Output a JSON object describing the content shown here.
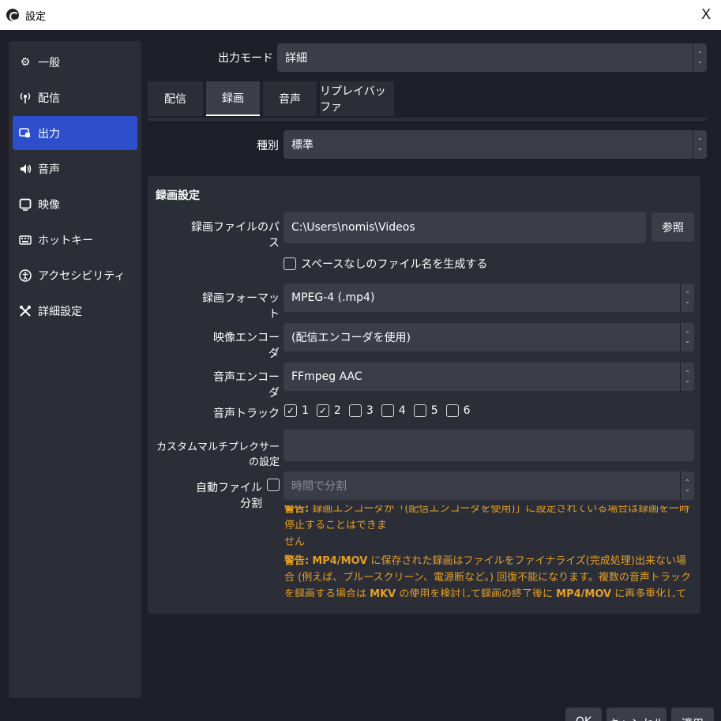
{
  "window": {
    "title": "設定",
    "close": "X"
  },
  "sidebar": {
    "items": [
      {
        "label": "一般",
        "icon": "gear-icon",
        "glyph": "⚙"
      },
      {
        "label": "配信",
        "icon": "broadcast-icon",
        "glyph": "📡"
      },
      {
        "label": "出力",
        "icon": "output-icon",
        "glyph": "🖵"
      },
      {
        "label": "音声",
        "icon": "speaker-icon",
        "glyph": "🔊"
      },
      {
        "label": "映像",
        "icon": "monitor-icon",
        "glyph": "▢"
      },
      {
        "label": "ホットキー",
        "icon": "keyboard-icon",
        "glyph": "⌨"
      },
      {
        "label": "アクセシビリティ",
        "icon": "accessibility-icon",
        "glyph": "♿"
      },
      {
        "label": "詳細設定",
        "icon": "tools-icon",
        "glyph": "✂"
      }
    ]
  },
  "output_mode": {
    "label": "出力モード",
    "value": "詳細"
  },
  "tabs": [
    {
      "label": "配信"
    },
    {
      "label": "録画"
    },
    {
      "label": "音声"
    },
    {
      "label": "リプレイバッファ"
    }
  ],
  "type_row": {
    "label": "種別",
    "value": "標準"
  },
  "recording": {
    "group_title": "録画設定",
    "path_label": "録画ファイルのパス",
    "path_value": "C:\\Users\\nomis\\Videos",
    "browse_button": "参照",
    "no_space_checkbox": "スペースなしのファイル名を生成する",
    "format_label": "録画フォーマット",
    "format_value": "MPEG-4 (.mp4)",
    "video_encoder_label": "映像エンコーダ",
    "video_encoder_value": "(配信エンコーダを使用)",
    "audio_encoder_label": "音声エンコーダ",
    "audio_encoder_value": "FFmpeg AAC",
    "audio_track_label": "音声トラック",
    "tracks": [
      {
        "num": "1",
        "checked": true
      },
      {
        "num": "2",
        "checked": true
      },
      {
        "num": "3",
        "checked": false
      },
      {
        "num": "4",
        "checked": false
      },
      {
        "num": "5",
        "checked": false
      },
      {
        "num": "6",
        "checked": false
      }
    ],
    "muxer_label": "カスタムマルチプレクサーの設定",
    "muxer_value": "",
    "autosplit_label": "自動ファイル分割",
    "autosplit_value": "時間で分割"
  },
  "warnings": {
    "w1_prefix": "警告:",
    "w1_text": "録画エンコーダが「(配信エンコーダを使用)」に設定されている場合は録画を一時停止することはできま",
    "w1_line2": "せん",
    "w2_prefix": "警告:",
    "w2_bold1": "MP4/MOV",
    "w2_text1": "に保存された録画はファイルをファイナライズ(完成処理)出来ない場合 (例えば、ブルースクリーン、電源断など。) 回復不能になります。複数の音声トラックを録画する場合は",
    "w2_bold2": "MKV",
    "w2_text2": "の使用を検討して録画の終了後に",
    "w2_bold3": "MP4/MOV",
    "w2_text3": "に再多重化してください。(ファイル → 録画の再多重化)"
  },
  "footer": {
    "ok": "OK",
    "cancel": "キャンセル",
    "apply": "適用"
  },
  "colors": {
    "accent": "#2d4fcc",
    "warning": "#e5a024",
    "panel": "#2b2d37",
    "field": "#3b3d48",
    "background": "#1e1f29"
  }
}
